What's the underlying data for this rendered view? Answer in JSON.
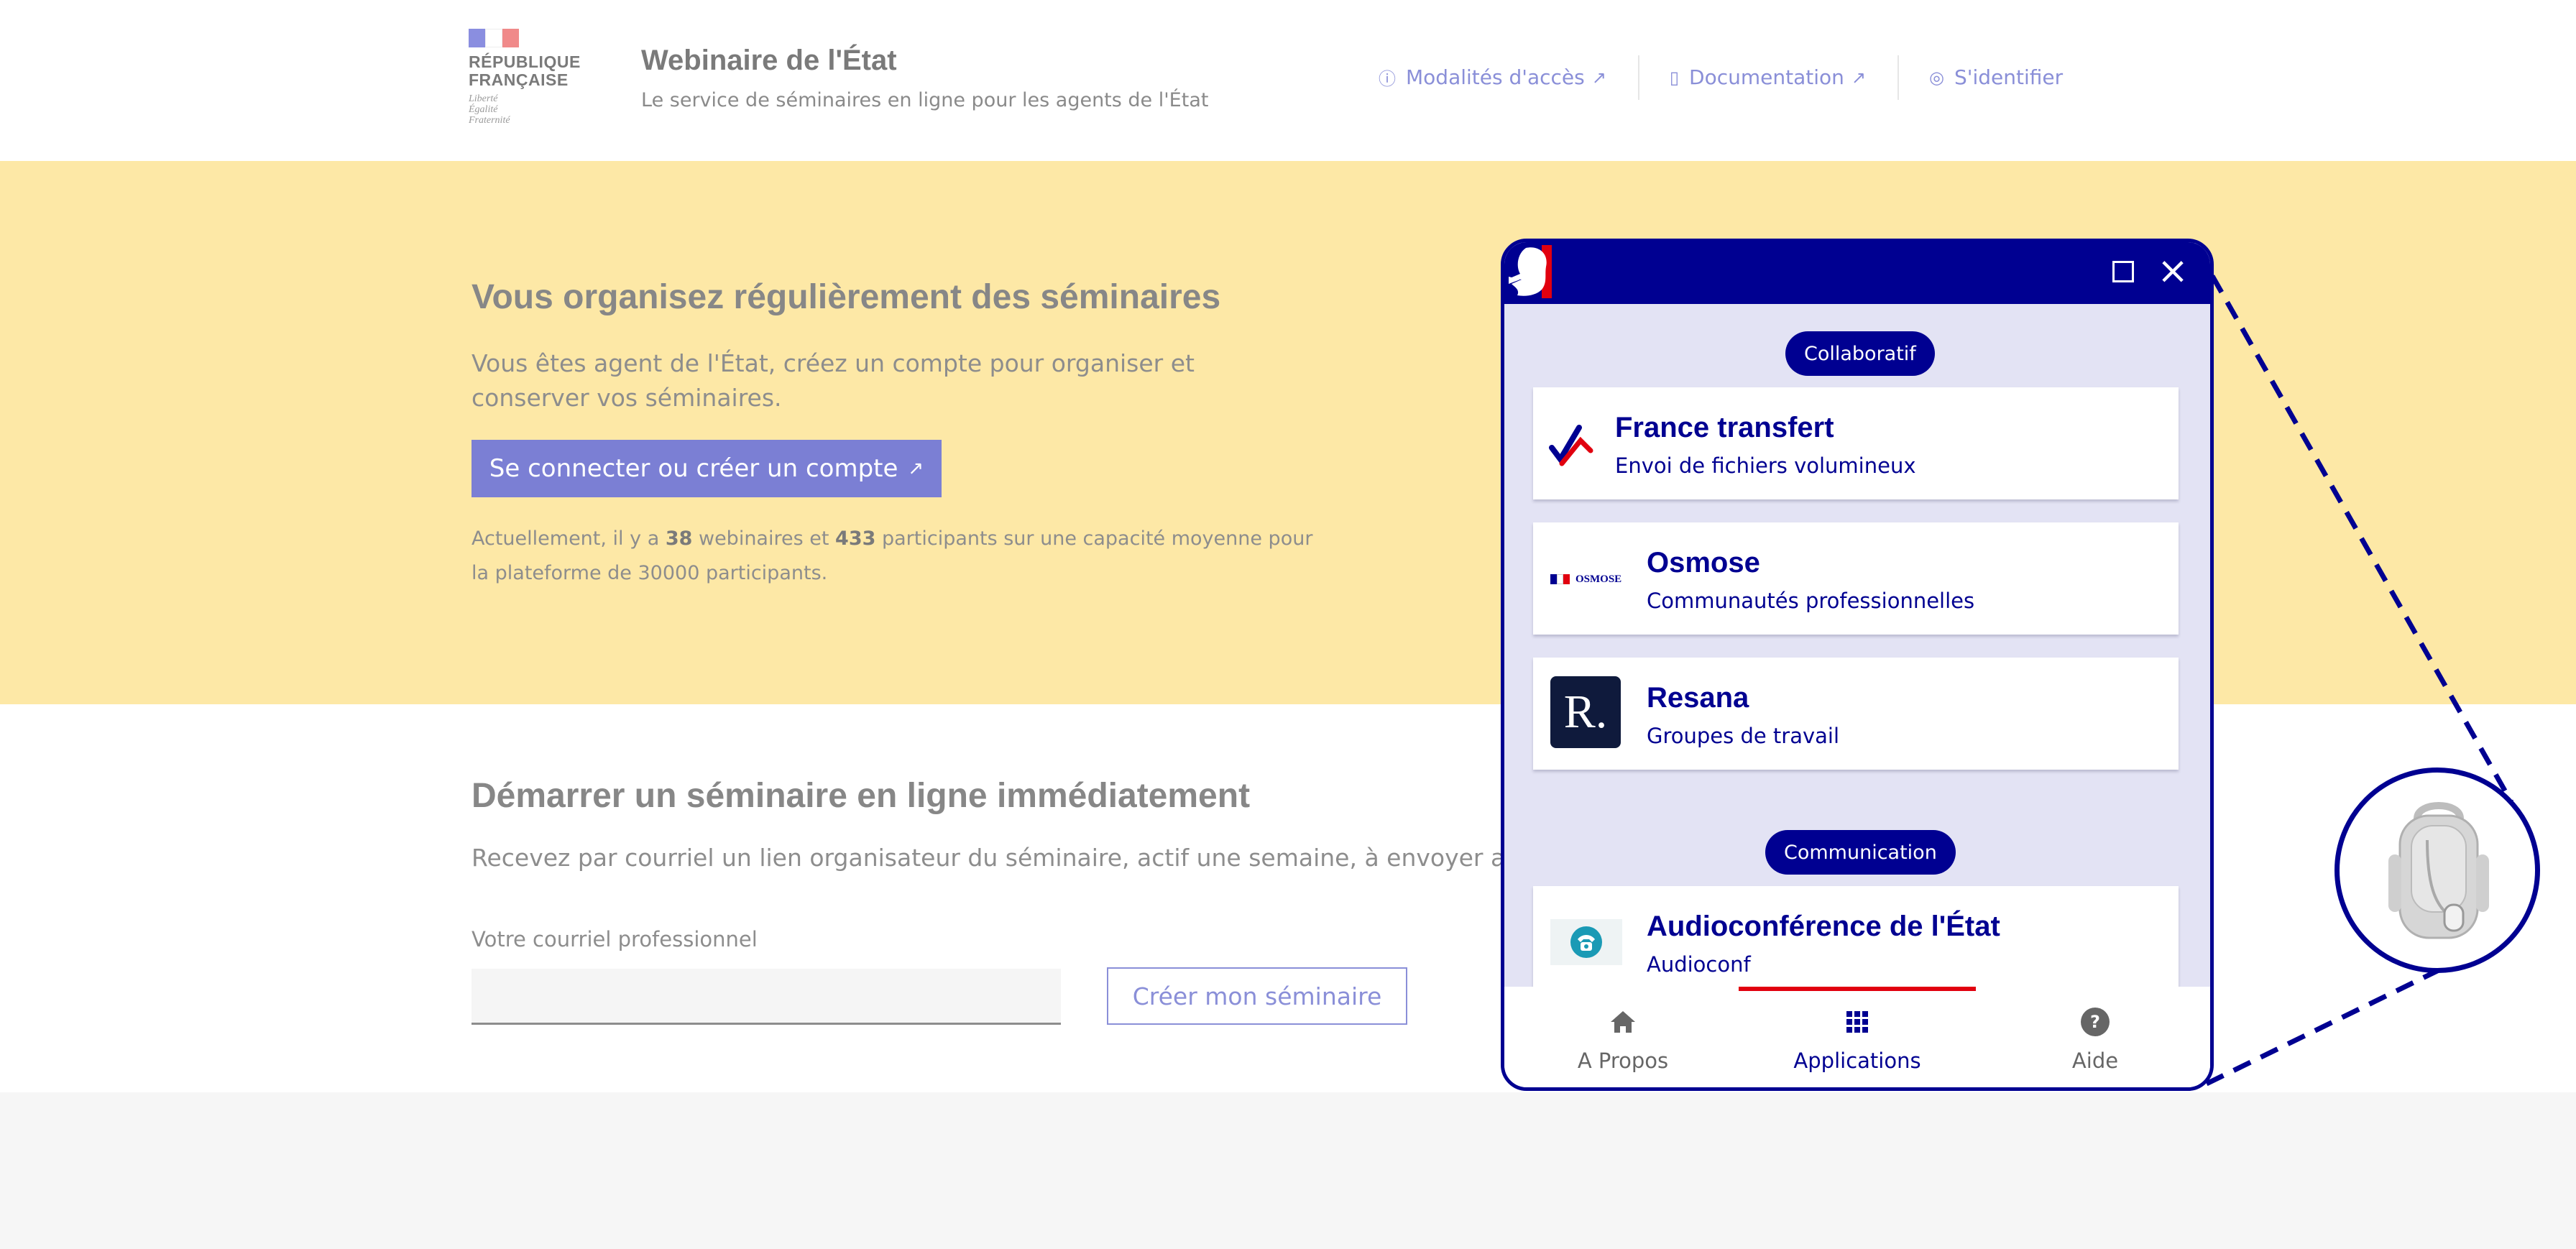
{
  "header": {
    "logo": {
      "line1": "RÉPUBLIQUE",
      "line2": "FRANÇAISE",
      "motto": [
        "Liberté",
        "Égalité",
        "Fraternité"
      ]
    },
    "title": "Webinaire de l'État",
    "tagline": "Le service de séminaires en ligne pour les agents de l'État",
    "nav": [
      {
        "label": "Modalités d'accès",
        "icon": "info-icon",
        "external": true
      },
      {
        "label": "Documentation",
        "icon": "book-icon",
        "external": true
      },
      {
        "label": "S'identifier",
        "icon": "user-icon",
        "external": false
      }
    ]
  },
  "hero": {
    "title": "Vous organisez régulièrement des séminaires",
    "lead": "Vous êtes agent de l'État, créez un compte pour organiser et conserver vos séminaires.",
    "cta": "Se connecter ou créer un compte",
    "stats": {
      "part1": "Actuellement, il y a ",
      "webinars": "38",
      "part2": " webinaires et ",
      "participants": "433",
      "part3": " participants sur une capacité moyenne pour la plateforme de 30000 participants."
    }
  },
  "start": {
    "title": "Démarrer un séminaire en ligne immédiatement",
    "lead": "Recevez par courriel un lien organisateur du séminaire, actif une semaine, à envoyer aux participants.",
    "email_label": "Votre courriel professionnel",
    "email_value": "",
    "button": "Créer mon séminaire"
  },
  "panel": {
    "categories": [
      "Collaboratif",
      "Communication"
    ],
    "apps": [
      {
        "name": "France transfert",
        "desc": "Envoi de fichiers volumineux",
        "icon": "france-transfert-icon"
      },
      {
        "name": "Osmose",
        "desc": "Communautés professionnelles",
        "icon": "osmose-icon",
        "logo_text": "OSMOSE"
      },
      {
        "name": "Resana",
        "desc": "Groupes de travail",
        "icon": "resana-icon",
        "logo_text": "R."
      },
      {
        "name": "Audioconférence de l'État",
        "desc": "Audioconf",
        "icon": "audioconf-icon"
      }
    ],
    "tabs": [
      {
        "label": "A Propos",
        "icon": "home-icon"
      },
      {
        "label": "Applications",
        "icon": "grid-icon",
        "active": true
      },
      {
        "label": "Aide",
        "icon": "help-icon"
      }
    ]
  },
  "colors": {
    "marianne_blue": "#000091",
    "marianne_red": "#e1000f",
    "hero_bg": "#fde8a6",
    "accent": "#7b7fd4"
  }
}
